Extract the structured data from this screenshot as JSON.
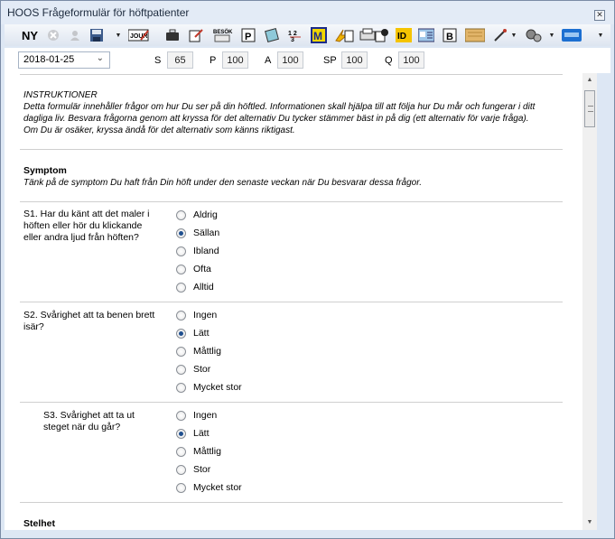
{
  "window": {
    "title": "HOOS Frågeformulär för höftpatienter"
  },
  "toolbar": {
    "ny_label": "NY"
  },
  "params": {
    "date": "2018-01-25",
    "fields": [
      {
        "label": "S",
        "value": "65"
      },
      {
        "label": "P",
        "value": "100"
      },
      {
        "label": "A",
        "value": "100"
      },
      {
        "label": "SP",
        "value": "100"
      },
      {
        "label": "Q",
        "value": "100"
      }
    ]
  },
  "instructions": {
    "heading": "INSTRUKTIONER",
    "text": "Detta formulär innehåller frågor om hur Du ser på din höftled. Informationen skall hjälpa till att följa hur Du mår och fungerar i ditt dagliga liv. Besvara frågorna genom att kryssa för det alternativ Du tycker stämmer bäst in på dig (ett alternativ för varje fråga). Om Du är osäker, kryssa ändå för det alternativ som känns riktigast."
  },
  "symptom": {
    "title": "Symptom",
    "desc": "Tänk på de symptom Du haft från Din höft under den senaste veckan när Du besvarar dessa frågor."
  },
  "questions": [
    {
      "text": "S1. Har du känt att det maler i höften eller hör du klickande eller andra ljud från höften?",
      "options": [
        "Aldrig",
        "Sällan",
        "Ibland",
        "Ofta",
        "Alltid"
      ],
      "selected": "Sällan"
    },
    {
      "text": "S2. Svårighet att ta benen brett isär?",
      "options": [
        "Ingen",
        "Lätt",
        "Måttlig",
        "Stor",
        "Mycket stor"
      ],
      "selected": "Lätt"
    },
    {
      "text": "S3. Svårighet att ta ut steget när du går?",
      "options": [
        "Ingen",
        "Lätt",
        "Måttlig",
        "Stor",
        "Mycket stor"
      ],
      "selected": "Lätt"
    }
  ],
  "next_section": {
    "title": "Stelhet"
  },
  "icons": [
    "stop-icon",
    "user-icon",
    "save-icon",
    "journal-icon",
    "briefcase-icon",
    "edit-icon",
    "besok-icon",
    "p-icon",
    "note-icon",
    "numbers-icon",
    "m-icon",
    "lightning-icon",
    "print-icon",
    "phone-icon",
    "id-icon",
    "card-icon",
    "b-icon",
    "map-icon",
    "tools-icon",
    "gears-icon",
    "software-icon"
  ]
}
